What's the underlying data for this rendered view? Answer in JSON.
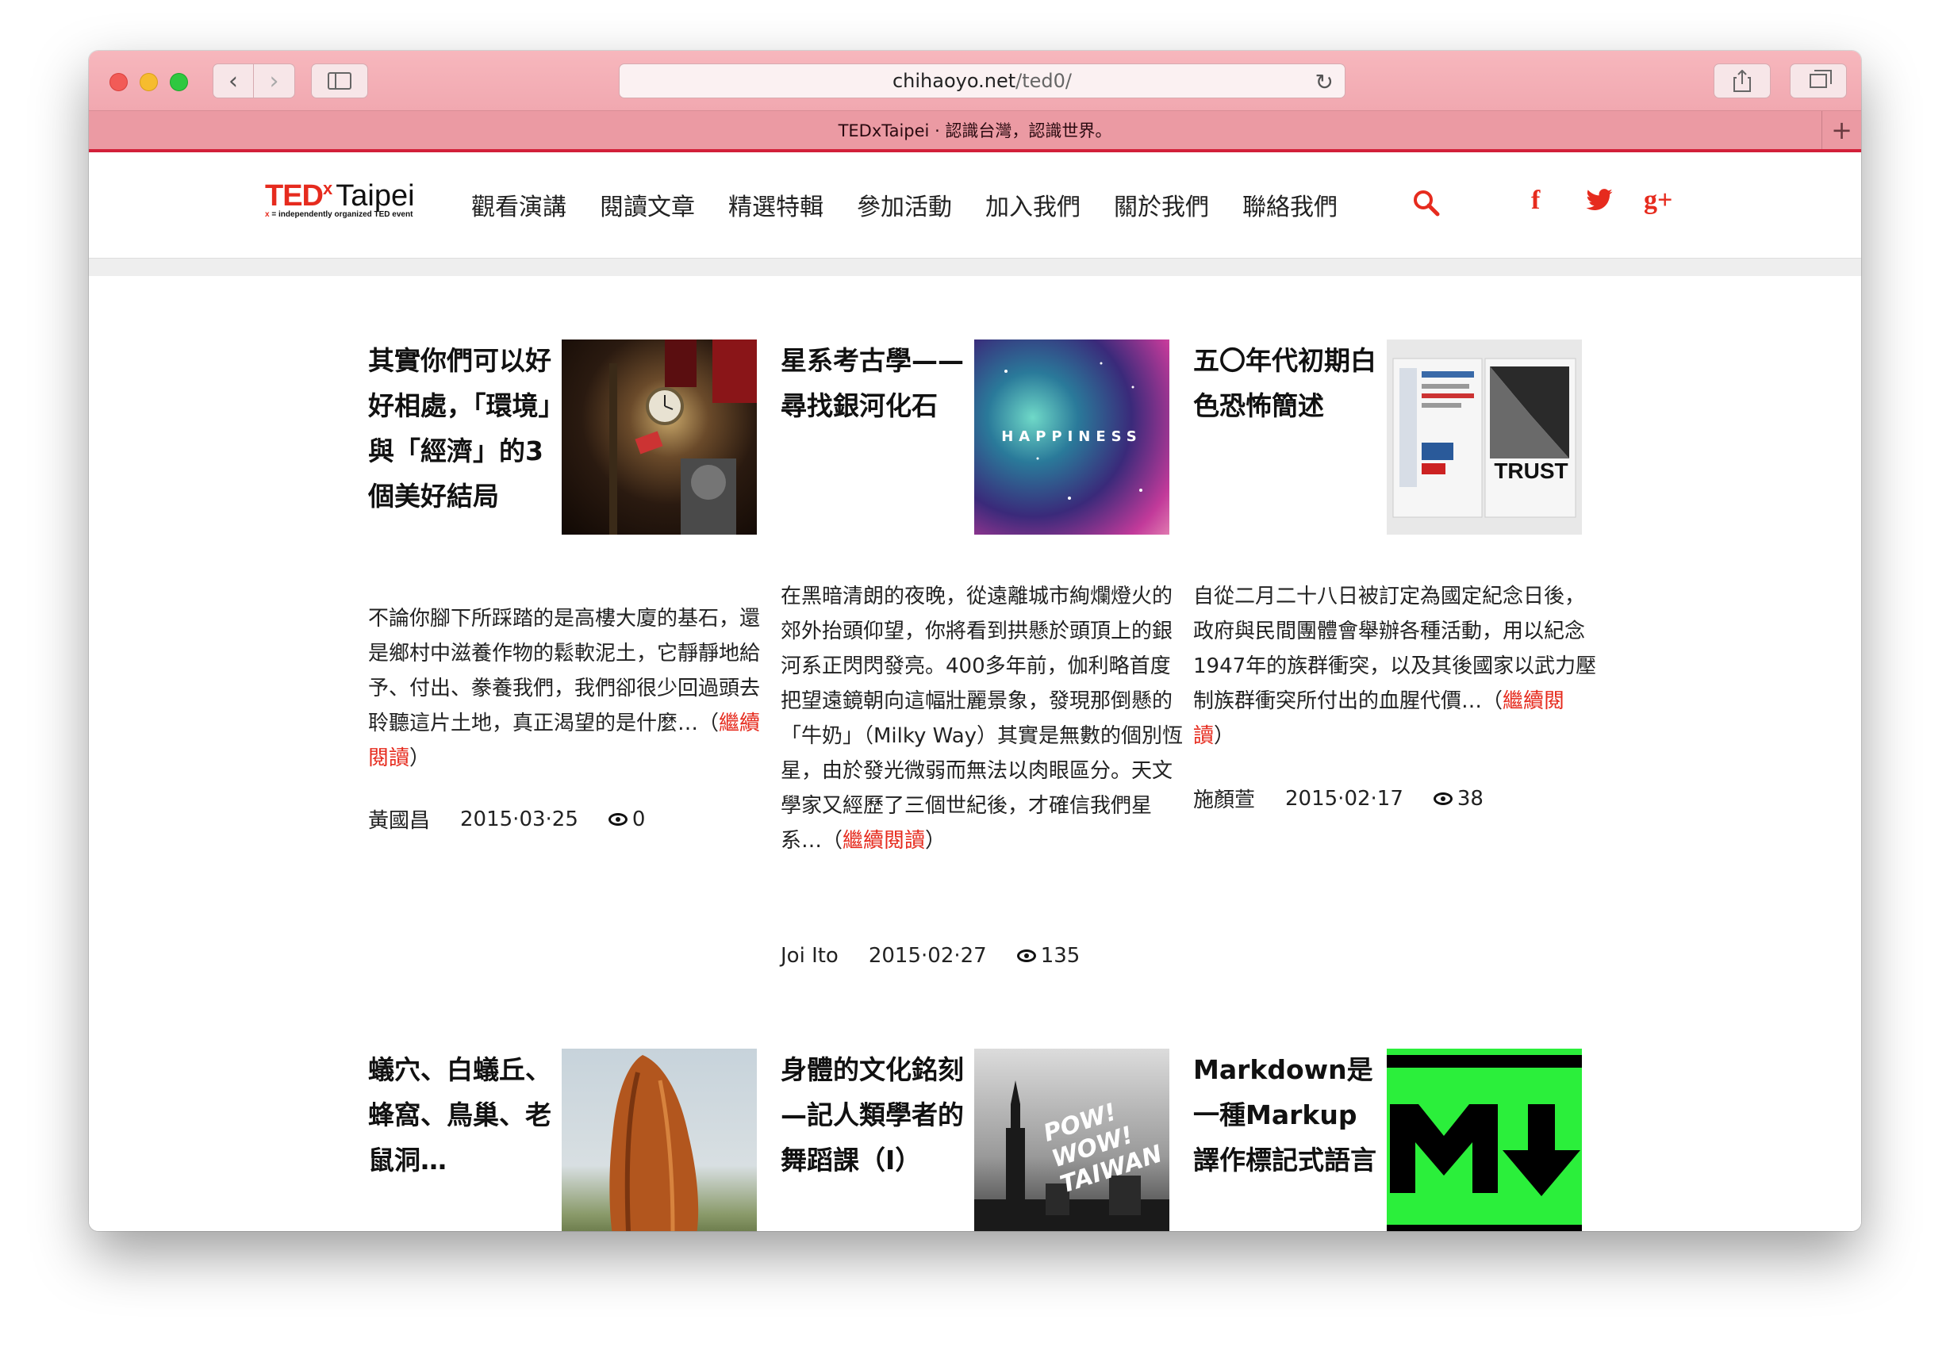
{
  "browser": {
    "url_host": "chihaoyo.net",
    "url_path": "/ted0/",
    "tab_title": "TEDxTaipei · 認識台灣，認識世界。"
  },
  "site": {
    "logo": {
      "ted": "TED",
      "x": "x",
      "city": "Taipei",
      "tag_x": "x",
      "tag_rest": " = independently organized TED event"
    },
    "nav": [
      "觀看演講",
      "閱讀文章",
      "精選特輯",
      "參加活動",
      "加入我們",
      "關於我們",
      "聯絡我們"
    ],
    "social": {
      "facebook": "f",
      "google": "g+"
    },
    "colors": {
      "brand": "#e62b1e"
    }
  },
  "articles": [
    {
      "title": "其實你們可以好好相處，「環境」與「經濟」的3個美好結局",
      "excerpt": "不論你腳下所踩踏的是高樓大廈的基石，還是鄉村中滋養作物的鬆軟泥土，它靜靜地給予、付出、豢養我們，我們卻很少回過頭去聆聽這片土地，真正渴望的是什麼…",
      "readmore": "繼續閱讀",
      "author": "黃國昌",
      "date": "2015·03·25",
      "views": "0",
      "thumb_icon": "clock-room-photo"
    },
    {
      "title": "星系考古學——尋找銀河化石",
      "excerpt": "在黑暗清朗的夜晚，從遠離城市絢爛燈火的郊外抬頭仰望，你將看到拱懸於頭頂上的銀河系正閃閃發亮。400多年前，伽利略首度把望遠鏡朝向這幅壯麗景象，發現那倒懸的「牛奶」（Milky Way）其實是無數的個別恆星，由於發光微弱而無法以肉眼區分。天文學家又經歷了三個世紀後，才確信我們星系…",
      "readmore": "繼續閱讀",
      "author": "Joi Ito",
      "date": "2015·02·27",
      "views": "135",
      "thumb_text": "HAPPINESS"
    },
    {
      "title": "五〇年代初期白色恐怖簡述",
      "excerpt": "自從二月二十八日被訂定為國定紀念日後，政府與民間團體會舉辦各種活動，用以紀念1947年的族群衝突，以及其後國家以武力壓制族群衝突所付出的血腥代價…",
      "readmore": "繼續閱讀",
      "author": "施顏萱",
      "date": "2015·02·17",
      "views": "38",
      "thumb_text": "TRUST"
    },
    {
      "title": "蟻穴、白蟻丘、蜂窩、鳥巢、老鼠洞…",
      "thumb_icon": "termite-mound-photo"
    },
    {
      "title": "身體的文化銘刻—記人類學者的舞蹈課（I）",
      "thumb_text": "POW! WOW! TAIWAN"
    },
    {
      "title": "Markdown是一種Markup譯作標記式語言",
      "thumb_icon": "markdown-logo"
    }
  ]
}
